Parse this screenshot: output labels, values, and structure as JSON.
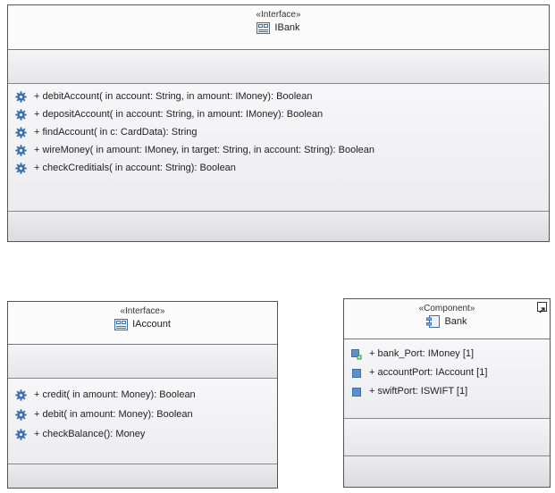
{
  "ibank": {
    "stereotype": "«Interface»",
    "name": "IBank",
    "operations": [
      "+ debitAccount(  in account: String,   in amount: IMoney): Boolean",
      "+ depositAccount(  in account: String,   in amount: IMoney): Boolean",
      "+ findAccount(  in c: CardData): String",
      "+ wireMoney(  in amount: IMoney,   in target: String,   in account: String): Boolean",
      "+ checkCreditials(  in account: String): Boolean"
    ]
  },
  "iaccount": {
    "stereotype": "«Interface»",
    "name": "IAccount",
    "operations": [
      "+ credit(  in amount: Money): Boolean",
      "+ debit(  in amount: Money): Boolean",
      "+ checkBalance(): Money"
    ]
  },
  "bank": {
    "stereotype": "«Component»",
    "name": "Bank",
    "ports": [
      "+ bank_Port: IMoney [1]",
      "+ accountPort: IAccount [1]",
      "+ swiftPort: ISWIFT [1]"
    ]
  },
  "colors": {
    "gear": "#3d6fa8",
    "port": "#5b8fd0",
    "provided_port_plus": "#2e9a3a",
    "border": "#555555"
  },
  "icons": {
    "interface": "interface-icon",
    "component": "component-icon",
    "operation": "operation-gear-icon",
    "port": "port-icon",
    "expand": "expand-icon"
  }
}
